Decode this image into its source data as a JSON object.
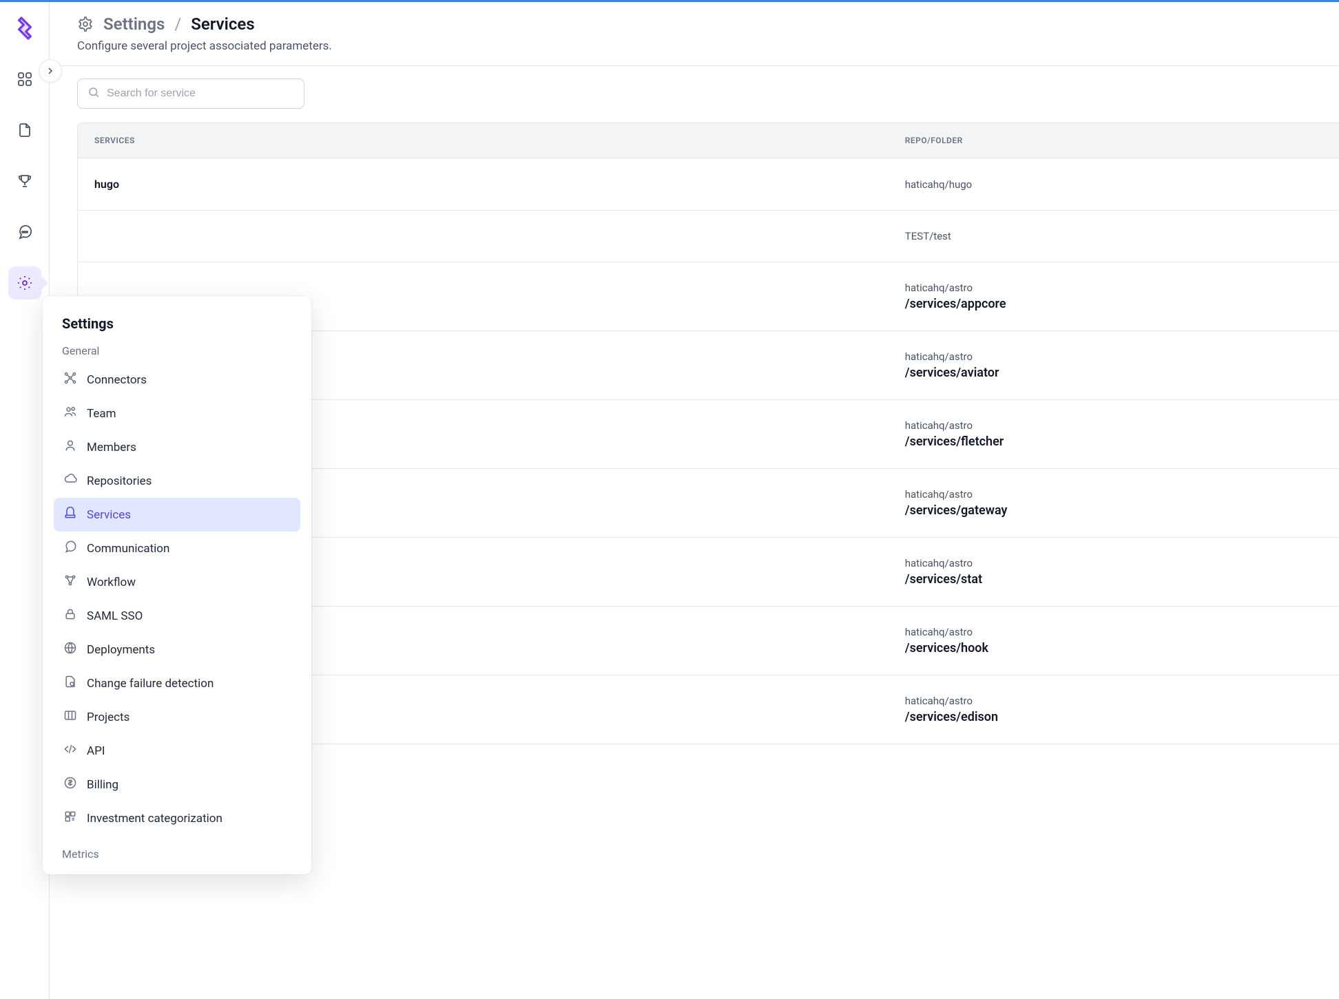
{
  "breadcrumb": {
    "parent": "Settings",
    "current": "Services"
  },
  "subtitle": "Configure several project associated parameters.",
  "search": {
    "placeholder": "Search for service"
  },
  "table": {
    "headers": {
      "services": "SERVICES",
      "repo": "REPO/FOLDER"
    },
    "rows": [
      {
        "service": "hugo",
        "repo": "haticahq/hugo",
        "folder": ""
      },
      {
        "service": "",
        "repo": "TEST/test",
        "folder": ""
      },
      {
        "service": "",
        "repo": "haticahq/astro",
        "folder": "/services/appcore"
      },
      {
        "service": "",
        "repo": "haticahq/astro",
        "folder": "/services/aviator"
      },
      {
        "service": "",
        "repo": "haticahq/astro",
        "folder": "/services/fletcher"
      },
      {
        "service": "",
        "repo": "haticahq/astro",
        "folder": "/services/gateway"
      },
      {
        "service": "",
        "repo": "haticahq/astro",
        "folder": "/services/stat"
      },
      {
        "service": "",
        "repo": "haticahq/astro",
        "folder": "/services/hook"
      },
      {
        "service": "",
        "repo": "haticahq/astro",
        "folder": "/services/edison"
      }
    ]
  },
  "flyout": {
    "title": "Settings",
    "section_general": "General",
    "section_metrics": "Metrics",
    "items": [
      {
        "label": "Connectors",
        "icon": "connectors",
        "active": false
      },
      {
        "label": "Team",
        "icon": "team",
        "active": false
      },
      {
        "label": "Members",
        "icon": "members",
        "active": false
      },
      {
        "label": "Repositories",
        "icon": "repos",
        "active": false
      },
      {
        "label": "Services",
        "icon": "services",
        "active": true
      },
      {
        "label": "Communication",
        "icon": "comm",
        "active": false
      },
      {
        "label": "Workflow",
        "icon": "workflow",
        "active": false
      },
      {
        "label": "SAML SSO",
        "icon": "lock",
        "active": false
      },
      {
        "label": "Deployments",
        "icon": "deploy",
        "active": false
      },
      {
        "label": "Change failure detection",
        "icon": "detect",
        "active": false
      },
      {
        "label": "Projects",
        "icon": "projects",
        "active": false
      },
      {
        "label": "API",
        "icon": "api",
        "active": false
      },
      {
        "label": "Billing",
        "icon": "billing",
        "active": false
      },
      {
        "label": "Investment categorization",
        "icon": "invest",
        "active": false
      }
    ]
  }
}
